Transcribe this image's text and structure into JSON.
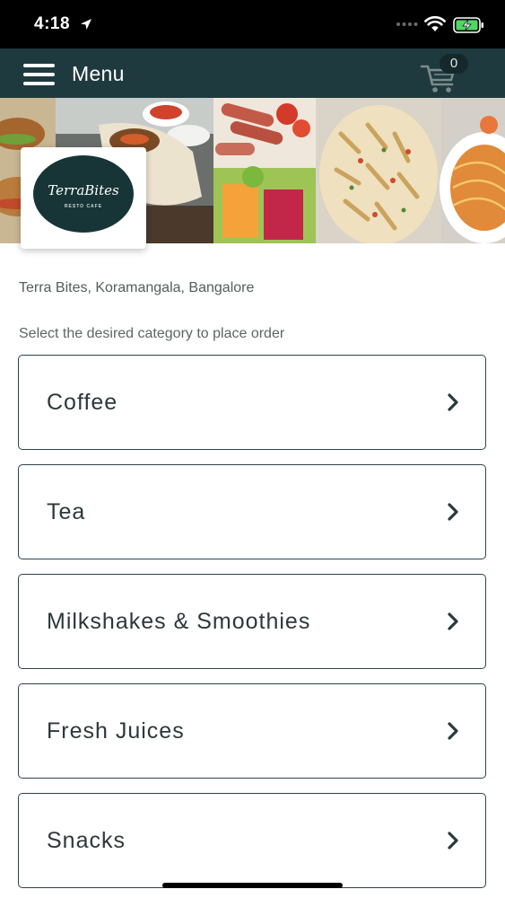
{
  "status_bar": {
    "time": "4:18",
    "icons": [
      "location-arrow-icon",
      "signal-dots-icon",
      "wifi-icon",
      "battery-charging-icon"
    ]
  },
  "header": {
    "title": "Menu",
    "cart_count": "0",
    "background": "#1f3a3e",
    "icons": [
      "hamburger-menu-icon",
      "cart-icon"
    ]
  },
  "restaurant": {
    "logo_name": "TerraBites",
    "logo_tagline": "RESTO CAFE",
    "address": "Terra Bites, Koramangala, Bangalore"
  },
  "instruction": "Select the desired category to place order",
  "categories": [
    {
      "label": "Coffee"
    },
    {
      "label": "Tea"
    },
    {
      "label": "Milkshakes & Smoothies"
    },
    {
      "label": "Fresh Juices"
    },
    {
      "label": "Snacks"
    }
  ],
  "colors": {
    "brand_dark": "#1f3a3e",
    "card_border": "#2d4446",
    "battery_green": "#4cd964"
  }
}
